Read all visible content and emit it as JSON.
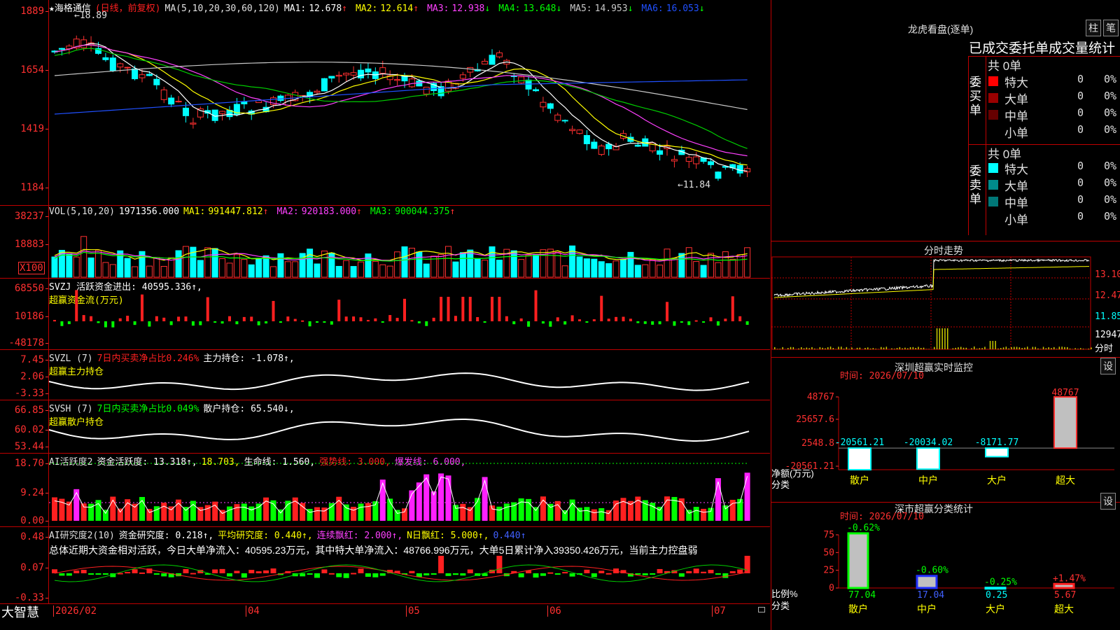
{
  "stock": {
    "star": "★",
    "name": "海格通信",
    "mode": "(日线，前复权)",
    "ma_label": "MA(5,10,20,30,60,120)",
    "ma": [
      {
        "k": "MA1:",
        "v": "12.678",
        "arrow": "↑",
        "color": "#ffffff"
      },
      {
        "k": "MA2:",
        "v": "12.614",
        "arrow": "↑",
        "color": "#ffff00"
      },
      {
        "k": "MA3:",
        "v": "12.938",
        "arrow": "↓",
        "color": "#ff40ff"
      },
      {
        "k": "MA4:",
        "v": "13.648",
        "arrow": "↓",
        "color": "#00ff00"
      },
      {
        "k": "MA5:",
        "v": "14.953",
        "arrow": "↓",
        "color": "#c8c8c8"
      },
      {
        "k": "MA6:",
        "v": "16.053",
        "arrow": "↓",
        "color": "#2050ff"
      }
    ],
    "price_axis": [
      "1889",
      "1654",
      "1419",
      "1184"
    ],
    "hi_label": "←18.89",
    "lo_label": "←11.84"
  },
  "vol": {
    "title": "VOL(5,10,20)",
    "value": "1971356.000",
    "ma": [
      {
        "k": "MA1:",
        "v": "991447.812",
        "arrow": "↑",
        "color": "#ffff00"
      },
      {
        "k": "MA2:",
        "v": "920183.000",
        "arrow": "↑",
        "color": "#ff40ff"
      },
      {
        "k": "MA3:",
        "v": "900044.375",
        "arrow": "↑",
        "color": "#00ff00"
      }
    ],
    "axis": [
      "38237",
      "18883"
    ],
    "unit": "X100"
  },
  "svzj": {
    "line1": "SVZJ  活跃资金进出: 40595.336↑,",
    "line2": "超赢资金流(万元)",
    "axis": [
      "68550",
      "10186",
      "-48178"
    ]
  },
  "svzl": {
    "name": "SVZL (7)",
    "desc": "7日内买卖净占比0.246%",
    "main": "主力持仓: -1.078↑,",
    "line2": "超赢主力持仓",
    "axis": [
      "7.45",
      "2.06",
      "-3.33"
    ]
  },
  "svsh": {
    "name": "SVSH (7)",
    "desc": "7日内买卖净占比0.049%",
    "main": "散户持仓: 65.540↓,",
    "line2": "超赢散户持仓",
    "axis": [
      "66.85",
      "60.02",
      "53.44"
    ]
  },
  "ai1": {
    "name": "AI活跃度2",
    "a": "资金活跃度: 13.318↑,",
    "b": "18.703,",
    "c": "生命线: 1.560,",
    "d": "强势线: 3.000,",
    "e": "爆发线: 6.000,",
    "axis": [
      "18.70",
      "9.24",
      "0.00"
    ]
  },
  "ai2": {
    "name": "AI研究度2(10)",
    "a": "资金研究度: 0.218↑,",
    "b": "平均研究度: 0.440↑,",
    "c": "连续飘红: 2.000↑,",
    "d": "N日飘红: 5.000↑,",
    "e": "0.440↑",
    "summary": "总体近期大资金相对活跃，今日大单净流入：40595.23万元，其中特大单净流入：48766.996万元，大单5日累计净入39350.426万元，当前主力控盘弱",
    "axis": [
      "0.48",
      "0.07",
      "-0.33"
    ]
  },
  "timeaxis": {
    "logo": "大智慧",
    "labels": [
      "2026/02",
      "04",
      "05",
      "06",
      "07"
    ]
  },
  "lhb": {
    "title": "龙虎看盘(逐单)",
    "btn1": "柱",
    "btn2": "笔",
    "sub": "已成交委托单成交量统计",
    "buy": {
      "side": "委买单",
      "total": "共 0单",
      "rows": [
        {
          "label": "特大",
          "v": "0",
          "p": "0%",
          "color": "#ff0000"
        },
        {
          "label": "大单",
          "v": "0",
          "p": "0%",
          "color": "#990000"
        },
        {
          "label": "中单",
          "v": "0",
          "p": "0%",
          "color": "#660000"
        },
        {
          "label": "小单",
          "v": "0",
          "p": "0%",
          "color": ""
        }
      ]
    },
    "sell": {
      "side": "委卖单",
      "total": "共 0单",
      "rows": [
        {
          "label": "特大",
          "v": "0",
          "p": "0%",
          "color": "#00ffff"
        },
        {
          "label": "大单",
          "v": "0",
          "p": "0%",
          "color": "#008b8b"
        },
        {
          "label": "中单",
          "v": "0",
          "p": "0%",
          "color": "#007777"
        },
        {
          "label": "小单",
          "v": "0",
          "p": "0%",
          "color": ""
        }
      ]
    }
  },
  "fenshi": {
    "title": "分时走势",
    "axis": [
      "13.10",
      "12.47",
      "11.85"
    ],
    "vol": "12947",
    "unit": "分时"
  },
  "sz_monitor": {
    "title": "深圳超赢实时监控",
    "btn": "设",
    "time": "时间: 2026/07/10",
    "axis": [
      "48767",
      "25657.6",
      "2548.8",
      "-20561.21"
    ],
    "ylabel": "净额(万元)",
    "xlabel": "分类",
    "cats": [
      "散户",
      "中户",
      "大户",
      "超大"
    ],
    "vals": [
      "-20561.21",
      "-20034.02",
      "-8171.77",
      "48767"
    ]
  },
  "sz_class": {
    "title": "深市超赢分类统计",
    "btn": "设",
    "time": "时间: 2026/07/10",
    "axis": [
      "75",
      "50",
      "25",
      "0"
    ],
    "ylabel": "比例%",
    "xlabel": "分类",
    "cats": [
      "散户",
      "中户",
      "大户",
      "超大"
    ],
    "pcts": [
      "77.04",
      "17.04",
      "0.25",
      "5.67"
    ],
    "chg": [
      "-0.62%",
      "-0.60%",
      "-0.25%",
      "+1.47%"
    ]
  },
  "chart_data": [
    {
      "type": "bar",
      "title": "深圳超赢实时监控",
      "ylabel": "净额(万元)",
      "xlabel": "分类",
      "categories": [
        "散户",
        "中户",
        "大户",
        "超大"
      ],
      "values": [
        -20561.21,
        -20034.02,
        -8171.77,
        48767
      ],
      "ylim": [
        -20561.21,
        48767
      ]
    },
    {
      "type": "bar",
      "title": "深市超赢分类统计",
      "ylabel": "比例%",
      "xlabel": "分类",
      "categories": [
        "散户",
        "中户",
        "大户",
        "超大"
      ],
      "values": [
        77.04,
        17.04,
        0.25,
        5.67
      ],
      "ylim": [
        0,
        75
      ]
    }
  ]
}
